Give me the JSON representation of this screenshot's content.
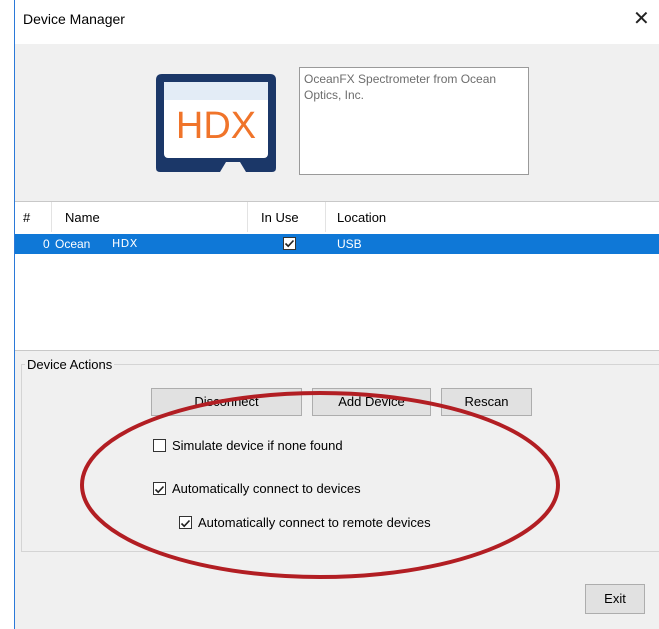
{
  "window": {
    "title": "Device Manager"
  },
  "logo": {
    "text": "HDX"
  },
  "device_description": "OceanFX Spectrometer from Ocean Optics, Inc.",
  "device_table": {
    "columns": [
      "#",
      "Name",
      "In Use",
      "Location"
    ],
    "rows": [
      {
        "index": "0",
        "name": "Ocean",
        "name_badge": "HDX",
        "in_use": true,
        "location": "USB"
      }
    ]
  },
  "device_actions": {
    "group_label": "Device Actions",
    "disconnect_label": "Disconnect",
    "add_device_label": "Add Device",
    "rescan_label": "Rescan",
    "simulate_label": "Simulate device if none found",
    "simulate_checked": false,
    "auto_connect_label": "Automatically connect to devices",
    "auto_connect_checked": true,
    "auto_remote_label": "Automatically connect to remote devices",
    "auto_remote_checked": true
  },
  "footer": {
    "exit_label": "Exit"
  },
  "colors": {
    "accent": "#0f78d7",
    "logo_orange": "#f0742a",
    "logo_navy": "#1b3768",
    "annotation": "#b21e23"
  },
  "icons": {
    "close": "close-icon",
    "check": "check-icon"
  }
}
